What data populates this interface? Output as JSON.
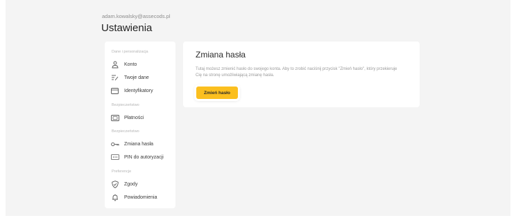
{
  "header": {
    "email": "adam.kowalsky@assecods.pl",
    "title": "Ustawienia"
  },
  "sidebar": {
    "sections": [
      {
        "label": "Dane i personalizacja",
        "items": [
          {
            "label": "Konto",
            "icon": "user-icon"
          },
          {
            "label": "Twoje dane",
            "icon": "edit-list-icon"
          },
          {
            "label": "Identyfikatory",
            "icon": "card-icon"
          }
        ]
      },
      {
        "label": "Bezpieczeństwo",
        "items": [
          {
            "label": "Płatności",
            "icon": "payment-icon"
          }
        ]
      },
      {
        "label": "Bezpieczeństwo",
        "items": [
          {
            "label": "Zmiana hasła",
            "icon": "key-icon"
          },
          {
            "label": "PIN do autoryzacji",
            "icon": "pin-icon"
          }
        ]
      },
      {
        "label": "Preferencje",
        "items": [
          {
            "label": "Zgody",
            "icon": "shield-check-icon"
          },
          {
            "label": "Powiadomienia",
            "icon": "bell-icon"
          }
        ]
      }
    ]
  },
  "main": {
    "title": "Zmiana hasła",
    "description": "Tutaj możesz zmienić hasło do swojego konta. Aby to zrobić naciśnij przycisk \"Zmień hasło\", który przekieruje Cię na stronę umożliwiającą zmianę hasła.",
    "button_label": "Zmień hasło"
  },
  "colors": {
    "accent": "#fbbf1f",
    "background": "#f4f4f4",
    "card": "#ffffff"
  }
}
